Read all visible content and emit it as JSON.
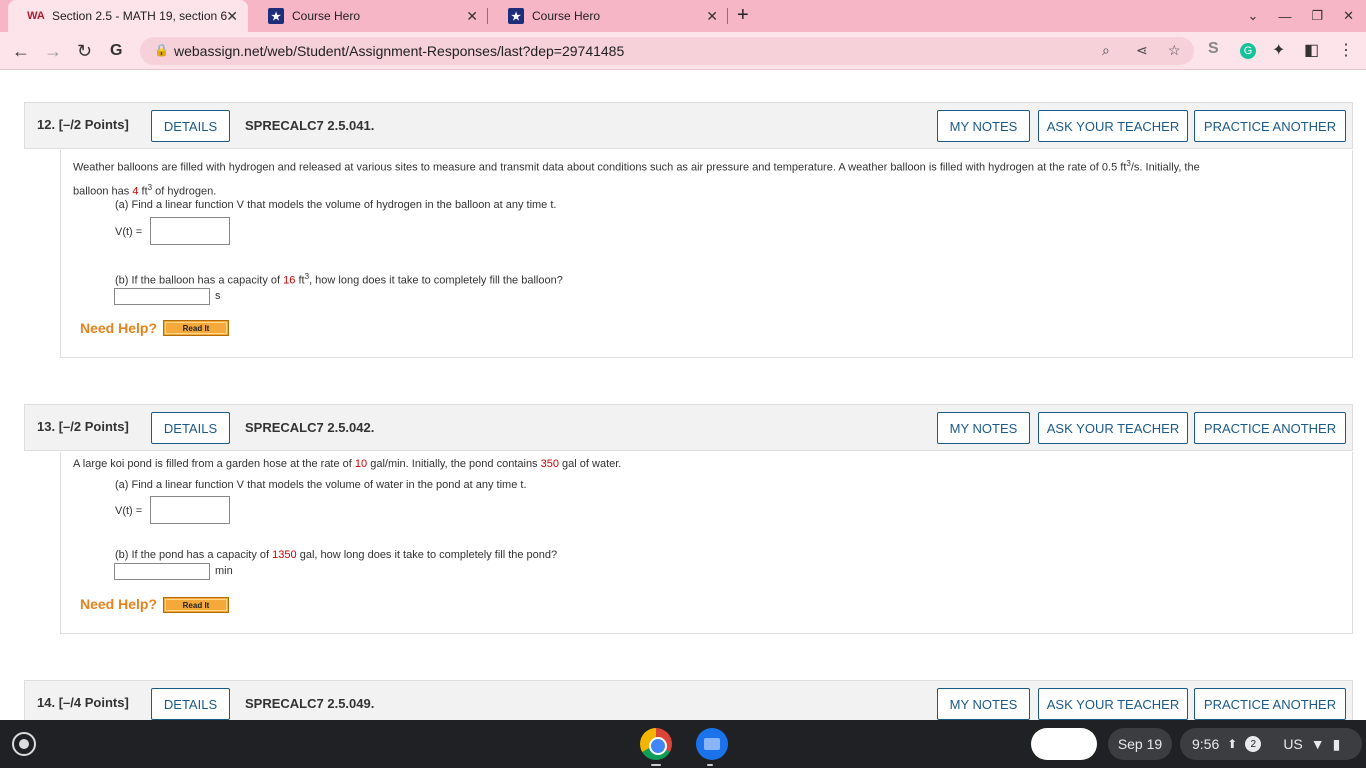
{
  "browser": {
    "tabs": [
      {
        "title": "Section 2.5 - MATH 19, section 6",
        "icon": "webassign-icon"
      },
      {
        "title": "Course Hero",
        "icon": "course-hero-icon"
      },
      {
        "title": "Course Hero",
        "icon": "course-hero-icon"
      }
    ],
    "url": "webassign.net/web/Student/Assignment-Responses/last?dep=29741485"
  },
  "questions": [
    {
      "number": "12.",
      "points": "[–/2 Points]",
      "details_label": "DETAILS",
      "code": "SPRECALC7 2.5.041.",
      "my_notes_label": "MY NOTES",
      "ask_teacher_label": "ASK YOUR TEACHER",
      "practice_label": "PRACTICE ANOTHER",
      "intro_1": "Weather balloons are filled with hydrogen and released at various sites to measure and transmit data about conditions such as air pressure and temperature. A weather balloon is filled with hydrogen at the rate of",
      "rate": "0.5",
      "rate_unit": "ft",
      "rate_unit_exp": "3",
      "rate_unit_suffix": "/s. Initially, the",
      "intro_2": "balloon has",
      "initial": "4",
      "initial_unit": "ft",
      "initial_unit_exp": "3",
      "intro_2_suffix": "of hydrogen.",
      "part_a": "(a) Find a linear function V that models the volume of hydrogen in the balloon at any time t.",
      "part_a_label": "V(t) =",
      "part_b_prefix": "(b) If the balloon has a capacity of",
      "capacity": "16",
      "capacity_unit": "ft",
      "capacity_unit_exp": "3",
      "part_b_suffix": ", how long does it take to completely fill the balloon?",
      "part_b_unit": "s",
      "need_help": "Need Help?",
      "read_it": "Read It"
    },
    {
      "number": "13.",
      "points": "[–/2 Points]",
      "details_label": "DETAILS",
      "code": "SPRECALC7 2.5.042.",
      "my_notes_label": "MY NOTES",
      "ask_teacher_label": "ASK YOUR TEACHER",
      "practice_label": "PRACTICE ANOTHER",
      "intro_1": "A large koi pond is filled from a garden hose at the rate of",
      "rate": "10",
      "rate_suffix": "gal/min. Initially, the pond contains",
      "initial": "350",
      "initial_suffix": "gal of water.",
      "part_a": "(a) Find a linear function V that models the volume of water in the pond at any time t.",
      "part_a_label": "V(t) =",
      "part_b_prefix": "(b) If the pond has a capacity of",
      "capacity": "1350",
      "part_b_suffix": "gal, how long does it take to completely fill the pond?",
      "part_b_unit": "min",
      "need_help": "Need Help?",
      "read_it": "Read It"
    },
    {
      "number": "14.",
      "points": "[–/4 Points]",
      "details_label": "DETAILS",
      "code": "SPRECALC7 2.5.049.",
      "my_notes_label": "MY NOTES",
      "ask_teacher_label": "ASK YOUR TEACHER",
      "practice_label": "PRACTICE ANOTHER"
    }
  ],
  "shelf": {
    "date": "Sep 19",
    "time": "9:56",
    "notification_count": "2",
    "locale": "US"
  },
  "colors": {
    "tab_strip": "#f7b6c6",
    "accent_blue": "#1c5a8a",
    "value_red": "#cc0000",
    "need_help_orange": "#e8821e"
  }
}
